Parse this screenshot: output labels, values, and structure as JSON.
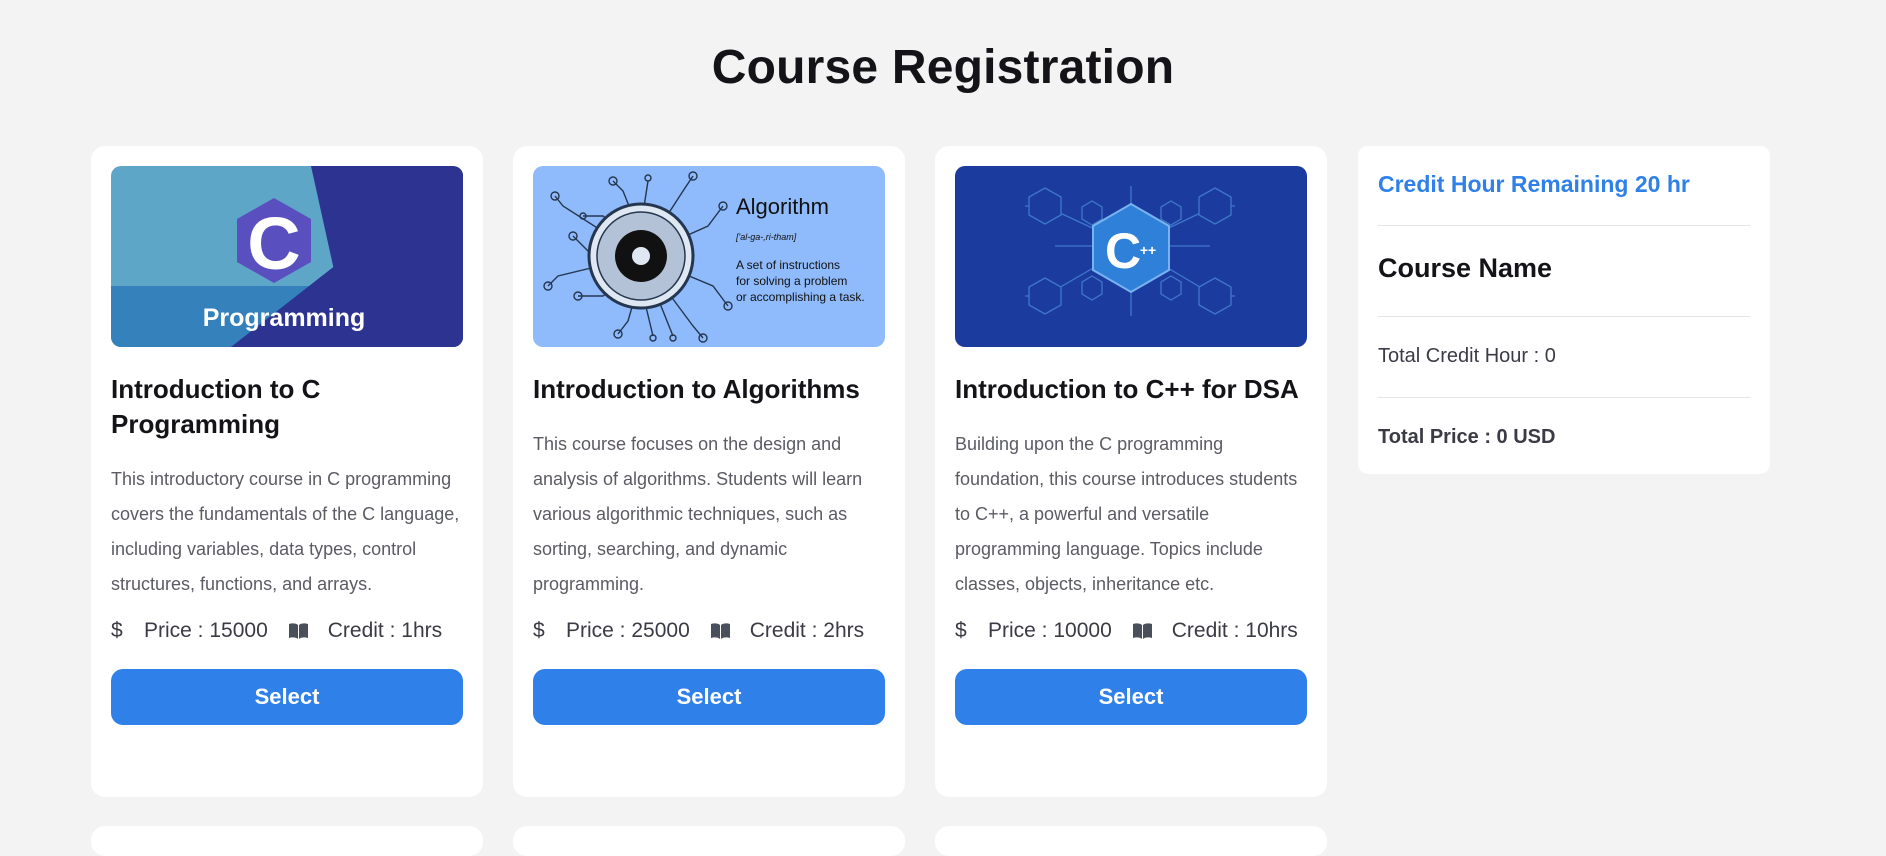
{
  "page": {
    "title": "Course Registration"
  },
  "courses": [
    {
      "title": "Introduction to C Programming",
      "image_text": "Programming",
      "image_letter": "C",
      "description": "This introductory course in C programming covers the fundamentals of the C language, including variables, data types, control structures, functions, and arrays.",
      "currency_symbol": "$",
      "price": "Price : 15000",
      "credit": "Credit : 1hrs",
      "button": "Select"
    },
    {
      "title": "Introduction to Algorithms",
      "image_heading": "Algorithm",
      "image_pron": "['al-ga-,ri-tham]",
      "image_def_1": "A set of instructions",
      "image_def_2": "for solving a problem",
      "image_def_3": "or accomplishing a task.",
      "description": "This course focuses on the design and analysis of algorithms. Students will learn various algorithmic techniques, such as sorting, searching, and dynamic programming.",
      "currency_symbol": "$",
      "price": "Price : 25000",
      "credit": "Credit : 2hrs",
      "button": "Select"
    },
    {
      "title": "Introduction to C++ for DSA",
      "image_letter": "C",
      "image_plus": "++",
      "description": "Building upon the C programming foundation, this course introduces students to C++, a powerful and versatile programming language. Topics include classes, objects, inheritance etc.",
      "currency_symbol": "$",
      "price": "Price : 10000",
      "credit": "Credit : 10hrs",
      "button": "Select"
    }
  ],
  "summary": {
    "remaining": "Credit Hour Remaining 20 hr",
    "course_name_heading": "Course Name",
    "total_credit": "Total Credit Hour : 0",
    "total_price": "Total Price : 0 USD"
  },
  "icons": {
    "price": "dollar-icon",
    "credit": "book-icon"
  },
  "colors": {
    "accent": "#2f80e9",
    "background": "#f3f3f3",
    "card": "#ffffff"
  }
}
